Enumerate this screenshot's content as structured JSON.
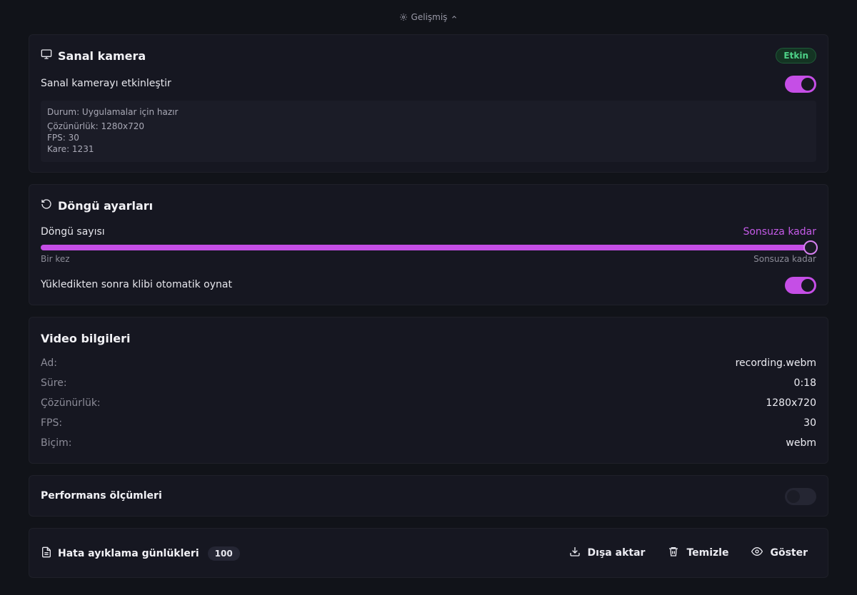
{
  "advanced": {
    "label": "Gelişmiş"
  },
  "virtual_camera": {
    "title": "Sanal kamera",
    "badge": "Etkin",
    "toggle_label": "Sanal kamerayı etkinleştir",
    "toggle_on": true,
    "status": {
      "state": "Durum: Uygulamalar için hazır",
      "resolution": "Çözünürlük: 1280x720",
      "fps": "FPS: 30",
      "frame": "Kare: 1231"
    }
  },
  "loop": {
    "title": "Döngü ayarları",
    "count_label": "Döngü sayısı",
    "count_value": "Sonsuza kadar",
    "slider_min": "Bir kez",
    "slider_max": "Sonsuza kadar",
    "slider_level": 1.0,
    "autoplay_label": "Yükledikten sonra klibi otomatik oynat",
    "autoplay_on": true
  },
  "video_info": {
    "title": "Video bilgileri",
    "rows": [
      {
        "key": "Ad:",
        "value": "recording.webm"
      },
      {
        "key": "Süre:",
        "value": "0:18"
      },
      {
        "key": "Çözünürlük:",
        "value": "1280x720"
      },
      {
        "key": "FPS:",
        "value": "30"
      },
      {
        "key": "Biçim:",
        "value": "webm"
      }
    ]
  },
  "performance": {
    "title": "Performans ölçümleri",
    "toggle_on": false
  },
  "debug_logs": {
    "title": "Hata ayıklama günlükleri",
    "count": "100",
    "export_label": "Dışa aktar",
    "clear_label": "Temizle",
    "show_label": "Göster"
  },
  "colors": {
    "accent": "#c54ee6",
    "success": "#4ed288",
    "background": "#111319",
    "card": "#161721"
  }
}
